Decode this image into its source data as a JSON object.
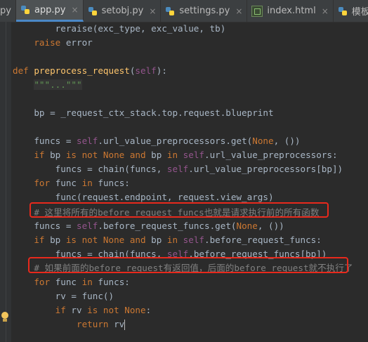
{
  "tabs": [
    {
      "label": "py",
      "icon": "python-file-icon",
      "active": false
    },
    {
      "label": "app.py",
      "icon": "python-file-icon",
      "active": true
    },
    {
      "label": "setobj.py",
      "icon": "python-file-icon",
      "active": false
    },
    {
      "label": "settings.py",
      "icon": "python-file-icon",
      "active": false
    },
    {
      "label": "index.html",
      "icon": "html-file-icon",
      "active": false
    },
    {
      "label": "模板渲染.",
      "icon": "python-file-icon",
      "active": false
    }
  ],
  "tab_close_glyph": "×",
  "code_lines": [
    {
      "indent": "        ",
      "tokens": [
        [
          "tx",
          "reraise(exc_type, exc_value, tb)"
        ]
      ]
    },
    {
      "indent": "    ",
      "tokens": [
        [
          "kw",
          "raise"
        ],
        [
          "tx",
          " error"
        ]
      ]
    },
    {
      "indent": "",
      "tokens": []
    },
    {
      "indent": "",
      "tokens": [
        [
          "kw",
          "def "
        ],
        [
          "fn",
          "preprocess_request"
        ],
        [
          "tx",
          "("
        ],
        [
          "sf",
          "self"
        ],
        [
          "tx",
          "):"
        ]
      ]
    },
    {
      "indent": "    ",
      "tokens": [
        [
          "ds",
          "\"\"\"...\"\"\""
        ]
      ]
    },
    {
      "indent": "",
      "tokens": []
    },
    {
      "indent": "    ",
      "tokens": [
        [
          "tx",
          "bp = _request_ctx_stack.top.request.blueprint"
        ]
      ]
    },
    {
      "indent": "",
      "tokens": []
    },
    {
      "indent": "    ",
      "tokens": [
        [
          "tx",
          "funcs = "
        ],
        [
          "sf",
          "self"
        ],
        [
          "tx",
          ".url_value_preprocessors.get("
        ],
        [
          "kw",
          "None"
        ],
        [
          "tx",
          ", ())"
        ]
      ]
    },
    {
      "indent": "    ",
      "tokens": [
        [
          "kw",
          "if "
        ],
        [
          "tx",
          "bp "
        ],
        [
          "kw",
          "is not None and "
        ],
        [
          "tx",
          "bp "
        ],
        [
          "kw",
          "in "
        ],
        [
          "sf",
          "self"
        ],
        [
          "tx",
          ".url_value_preprocessors:"
        ]
      ]
    },
    {
      "indent": "        ",
      "tokens": [
        [
          "tx",
          "funcs = chain(funcs, "
        ],
        [
          "sf",
          "self"
        ],
        [
          "tx",
          ".url_value_preprocessors[bp])"
        ]
      ]
    },
    {
      "indent": "    ",
      "tokens": [
        [
          "kw",
          "for "
        ],
        [
          "tx",
          "func "
        ],
        [
          "kw",
          "in "
        ],
        [
          "tx",
          "funcs:"
        ]
      ]
    },
    {
      "indent": "        ",
      "tokens": [
        [
          "tx",
          "func(request.endpoint, request.view_args)"
        ]
      ]
    },
    {
      "indent": "    ",
      "tokens": [
        [
          "cm",
          "# 这里将所有的before_request_funcs也就是请求执行前的所有函数"
        ]
      ]
    },
    {
      "indent": "    ",
      "tokens": [
        [
          "tx",
          "funcs = "
        ],
        [
          "sf",
          "self"
        ],
        [
          "tx",
          ".before_request_funcs.get("
        ],
        [
          "kw",
          "None"
        ],
        [
          "tx",
          ", ())"
        ]
      ]
    },
    {
      "indent": "    ",
      "tokens": [
        [
          "kw",
          "if "
        ],
        [
          "tx",
          "bp "
        ],
        [
          "kw",
          "is not None and "
        ],
        [
          "tx",
          "bp "
        ],
        [
          "kw",
          "in "
        ],
        [
          "sf",
          "self"
        ],
        [
          "tx",
          ".before_request_funcs:"
        ]
      ]
    },
    {
      "indent": "        ",
      "tokens": [
        [
          "tx",
          "funcs = chain(funcs, "
        ],
        [
          "sf",
          "self"
        ],
        [
          "tx",
          ".before_request_funcs[bp])"
        ]
      ]
    },
    {
      "indent": "    ",
      "tokens": [
        [
          "cm",
          "# 如果前面的before_request有返回值，后面的before_request就不执行了"
        ]
      ]
    },
    {
      "indent": "    ",
      "tokens": [
        [
          "kw",
          "for "
        ],
        [
          "tx",
          "func "
        ],
        [
          "kw",
          "in "
        ],
        [
          "tx",
          "funcs:"
        ]
      ]
    },
    {
      "indent": "        ",
      "tokens": [
        [
          "tx",
          "rv = func()"
        ]
      ]
    },
    {
      "indent": "        ",
      "tokens": [
        [
          "kw",
          "if "
        ],
        [
          "tx",
          "rv "
        ],
        [
          "kw",
          "is not None"
        ],
        [
          "tx",
          ":"
        ]
      ]
    },
    {
      "indent": "            ",
      "tokens": [
        [
          "kw",
          "return "
        ],
        [
          "tx",
          "rv"
        ]
      ]
    }
  ],
  "colors": {
    "editor_bg": "#2b2b2b",
    "keyword": "#cc7832",
    "function": "#ffc66d",
    "self": "#94558d",
    "comment": "#808080",
    "text": "#a9b7c6",
    "highlight_box": "#e8291c"
  }
}
